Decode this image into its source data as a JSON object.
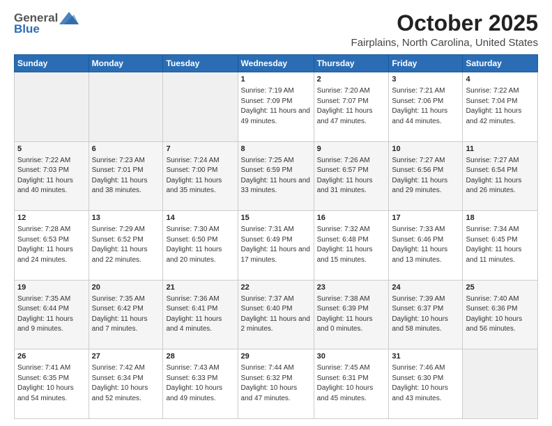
{
  "header": {
    "logo_general": "General",
    "logo_blue": "Blue",
    "month": "October 2025",
    "location": "Fairplains, North Carolina, United States"
  },
  "weekdays": [
    "Sunday",
    "Monday",
    "Tuesday",
    "Wednesday",
    "Thursday",
    "Friday",
    "Saturday"
  ],
  "weeks": [
    [
      {
        "day": "",
        "sunrise": "",
        "sunset": "",
        "daylight": ""
      },
      {
        "day": "",
        "sunrise": "",
        "sunset": "",
        "daylight": ""
      },
      {
        "day": "",
        "sunrise": "",
        "sunset": "",
        "daylight": ""
      },
      {
        "day": "1",
        "sunrise": "Sunrise: 7:19 AM",
        "sunset": "Sunset: 7:09 PM",
        "daylight": "Daylight: 11 hours and 49 minutes."
      },
      {
        "day": "2",
        "sunrise": "Sunrise: 7:20 AM",
        "sunset": "Sunset: 7:07 PM",
        "daylight": "Daylight: 11 hours and 47 minutes."
      },
      {
        "day": "3",
        "sunrise": "Sunrise: 7:21 AM",
        "sunset": "Sunset: 7:06 PM",
        "daylight": "Daylight: 11 hours and 44 minutes."
      },
      {
        "day": "4",
        "sunrise": "Sunrise: 7:22 AM",
        "sunset": "Sunset: 7:04 PM",
        "daylight": "Daylight: 11 hours and 42 minutes."
      }
    ],
    [
      {
        "day": "5",
        "sunrise": "Sunrise: 7:22 AM",
        "sunset": "Sunset: 7:03 PM",
        "daylight": "Daylight: 11 hours and 40 minutes."
      },
      {
        "day": "6",
        "sunrise": "Sunrise: 7:23 AM",
        "sunset": "Sunset: 7:01 PM",
        "daylight": "Daylight: 11 hours and 38 minutes."
      },
      {
        "day": "7",
        "sunrise": "Sunrise: 7:24 AM",
        "sunset": "Sunset: 7:00 PM",
        "daylight": "Daylight: 11 hours and 35 minutes."
      },
      {
        "day": "8",
        "sunrise": "Sunrise: 7:25 AM",
        "sunset": "Sunset: 6:59 PM",
        "daylight": "Daylight: 11 hours and 33 minutes."
      },
      {
        "day": "9",
        "sunrise": "Sunrise: 7:26 AM",
        "sunset": "Sunset: 6:57 PM",
        "daylight": "Daylight: 11 hours and 31 minutes."
      },
      {
        "day": "10",
        "sunrise": "Sunrise: 7:27 AM",
        "sunset": "Sunset: 6:56 PM",
        "daylight": "Daylight: 11 hours and 29 minutes."
      },
      {
        "day": "11",
        "sunrise": "Sunrise: 7:27 AM",
        "sunset": "Sunset: 6:54 PM",
        "daylight": "Daylight: 11 hours and 26 minutes."
      }
    ],
    [
      {
        "day": "12",
        "sunrise": "Sunrise: 7:28 AM",
        "sunset": "Sunset: 6:53 PM",
        "daylight": "Daylight: 11 hours and 24 minutes."
      },
      {
        "day": "13",
        "sunrise": "Sunrise: 7:29 AM",
        "sunset": "Sunset: 6:52 PM",
        "daylight": "Daylight: 11 hours and 22 minutes."
      },
      {
        "day": "14",
        "sunrise": "Sunrise: 7:30 AM",
        "sunset": "Sunset: 6:50 PM",
        "daylight": "Daylight: 11 hours and 20 minutes."
      },
      {
        "day": "15",
        "sunrise": "Sunrise: 7:31 AM",
        "sunset": "Sunset: 6:49 PM",
        "daylight": "Daylight: 11 hours and 17 minutes."
      },
      {
        "day": "16",
        "sunrise": "Sunrise: 7:32 AM",
        "sunset": "Sunset: 6:48 PM",
        "daylight": "Daylight: 11 hours and 15 minutes."
      },
      {
        "day": "17",
        "sunrise": "Sunrise: 7:33 AM",
        "sunset": "Sunset: 6:46 PM",
        "daylight": "Daylight: 11 hours and 13 minutes."
      },
      {
        "day": "18",
        "sunrise": "Sunrise: 7:34 AM",
        "sunset": "Sunset: 6:45 PM",
        "daylight": "Daylight: 11 hours and 11 minutes."
      }
    ],
    [
      {
        "day": "19",
        "sunrise": "Sunrise: 7:35 AM",
        "sunset": "Sunset: 6:44 PM",
        "daylight": "Daylight: 11 hours and 9 minutes."
      },
      {
        "day": "20",
        "sunrise": "Sunrise: 7:35 AM",
        "sunset": "Sunset: 6:42 PM",
        "daylight": "Daylight: 11 hours and 7 minutes."
      },
      {
        "day": "21",
        "sunrise": "Sunrise: 7:36 AM",
        "sunset": "Sunset: 6:41 PM",
        "daylight": "Daylight: 11 hours and 4 minutes."
      },
      {
        "day": "22",
        "sunrise": "Sunrise: 7:37 AM",
        "sunset": "Sunset: 6:40 PM",
        "daylight": "Daylight: 11 hours and 2 minutes."
      },
      {
        "day": "23",
        "sunrise": "Sunrise: 7:38 AM",
        "sunset": "Sunset: 6:39 PM",
        "daylight": "Daylight: 11 hours and 0 minutes."
      },
      {
        "day": "24",
        "sunrise": "Sunrise: 7:39 AM",
        "sunset": "Sunset: 6:37 PM",
        "daylight": "Daylight: 10 hours and 58 minutes."
      },
      {
        "day": "25",
        "sunrise": "Sunrise: 7:40 AM",
        "sunset": "Sunset: 6:36 PM",
        "daylight": "Daylight: 10 hours and 56 minutes."
      }
    ],
    [
      {
        "day": "26",
        "sunrise": "Sunrise: 7:41 AM",
        "sunset": "Sunset: 6:35 PM",
        "daylight": "Daylight: 10 hours and 54 minutes."
      },
      {
        "day": "27",
        "sunrise": "Sunrise: 7:42 AM",
        "sunset": "Sunset: 6:34 PM",
        "daylight": "Daylight: 10 hours and 52 minutes."
      },
      {
        "day": "28",
        "sunrise": "Sunrise: 7:43 AM",
        "sunset": "Sunset: 6:33 PM",
        "daylight": "Daylight: 10 hours and 49 minutes."
      },
      {
        "day": "29",
        "sunrise": "Sunrise: 7:44 AM",
        "sunset": "Sunset: 6:32 PM",
        "daylight": "Daylight: 10 hours and 47 minutes."
      },
      {
        "day": "30",
        "sunrise": "Sunrise: 7:45 AM",
        "sunset": "Sunset: 6:31 PM",
        "daylight": "Daylight: 10 hours and 45 minutes."
      },
      {
        "day": "31",
        "sunrise": "Sunrise: 7:46 AM",
        "sunset": "Sunset: 6:30 PM",
        "daylight": "Daylight: 10 hours and 43 minutes."
      },
      {
        "day": "",
        "sunrise": "",
        "sunset": "",
        "daylight": ""
      }
    ]
  ]
}
